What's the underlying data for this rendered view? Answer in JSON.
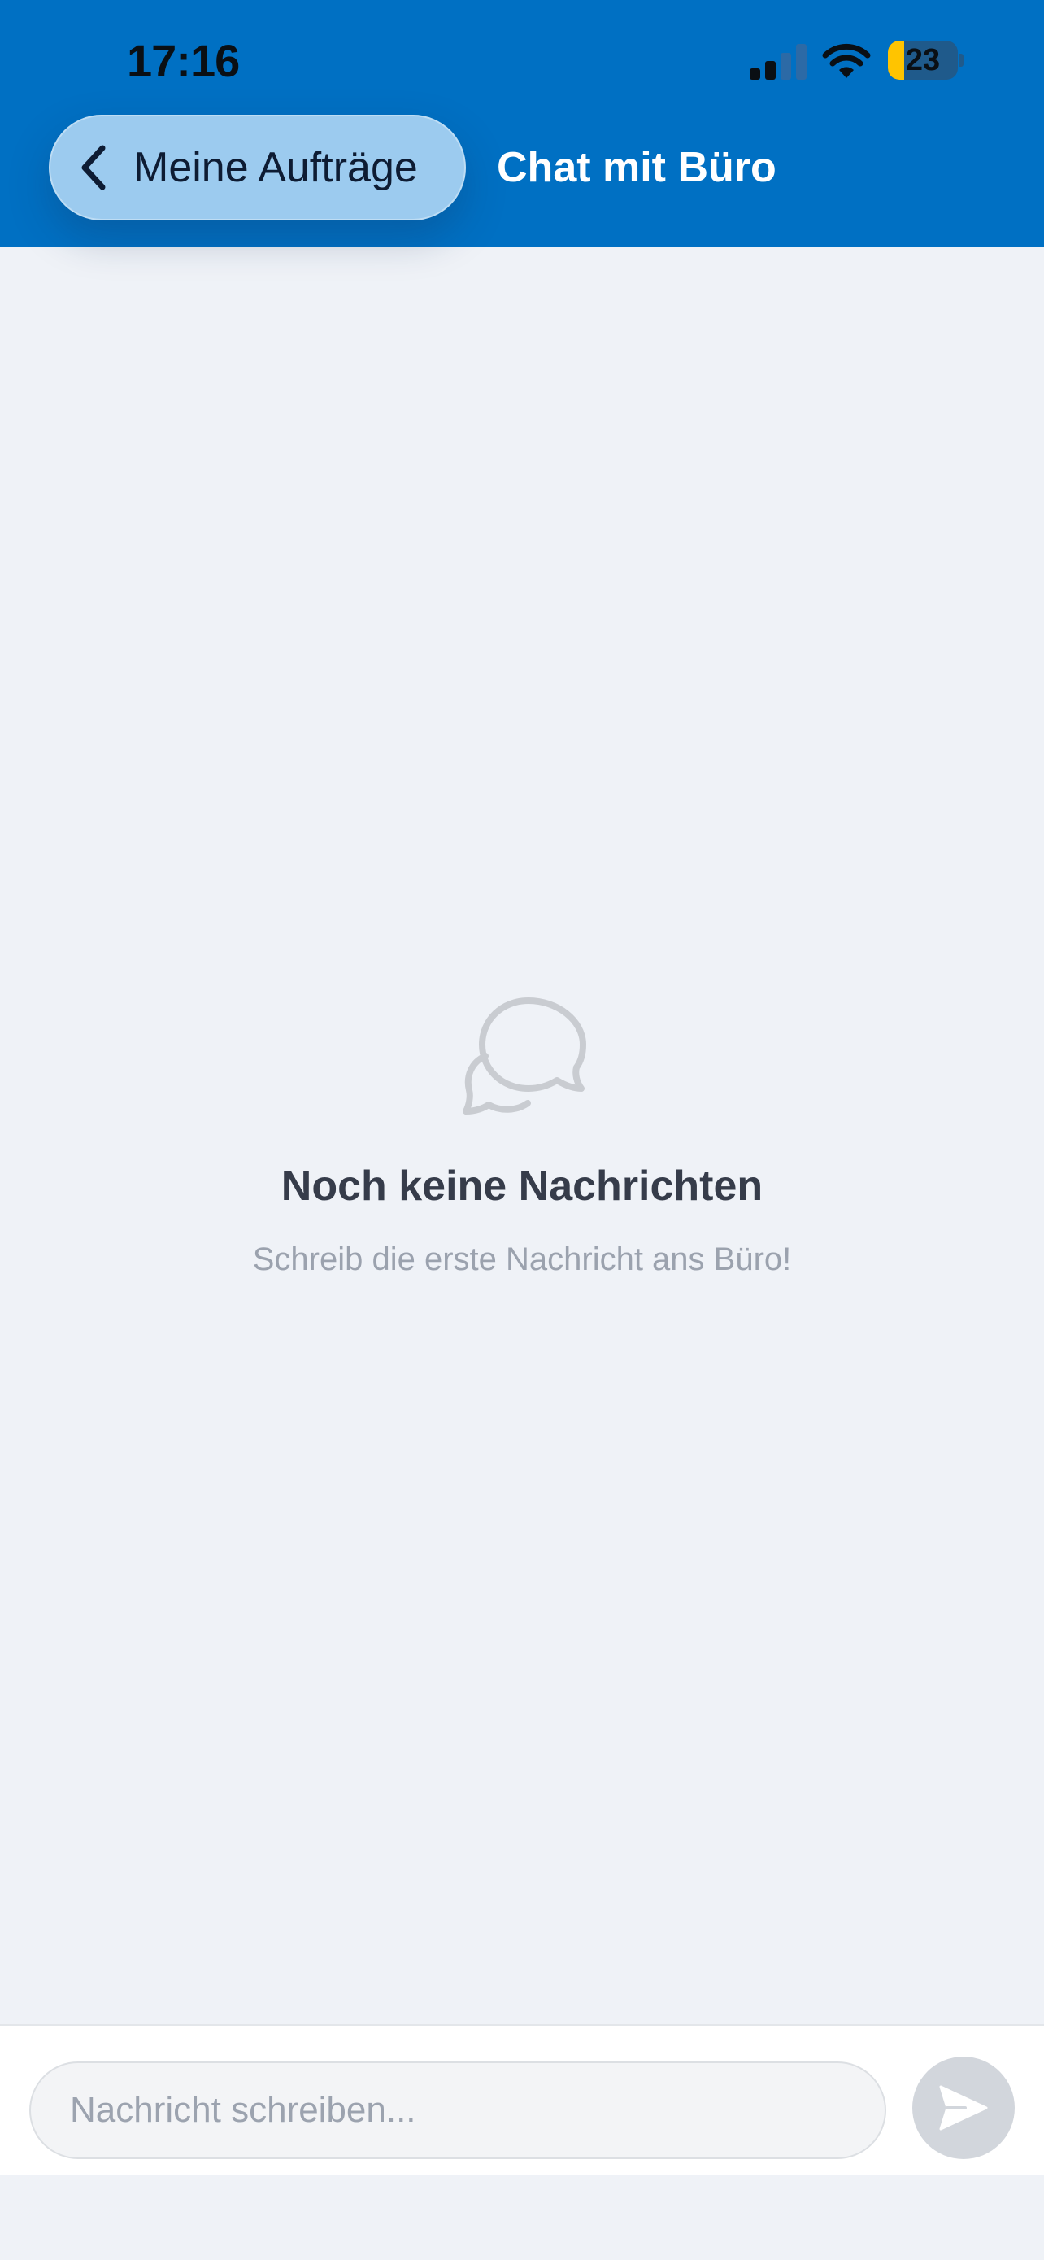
{
  "status_bar": {
    "time": "17:16",
    "battery_level": "23",
    "battery_fraction": 0.23,
    "signal_bars_active": 2,
    "signal_bars_total": 4
  },
  "header": {
    "back_label": "Meine Aufträge",
    "title": "Chat mit Büro"
  },
  "empty_state": {
    "icon": "chat-bubbles-icon",
    "title": "Noch keine Nachrichten",
    "subtitle": "Schreib die erste Nachricht ans Büro!"
  },
  "composer": {
    "value": "",
    "placeholder": "Nachricht schreiben...",
    "send_icon": "send-icon"
  },
  "colors": {
    "header_bg": "#0070c3",
    "back_button_bg": "#9ccbef",
    "page_bg": "#eff2f7",
    "battery_fill": "#ffc400",
    "send_button_bg": "#d2d6dc"
  }
}
